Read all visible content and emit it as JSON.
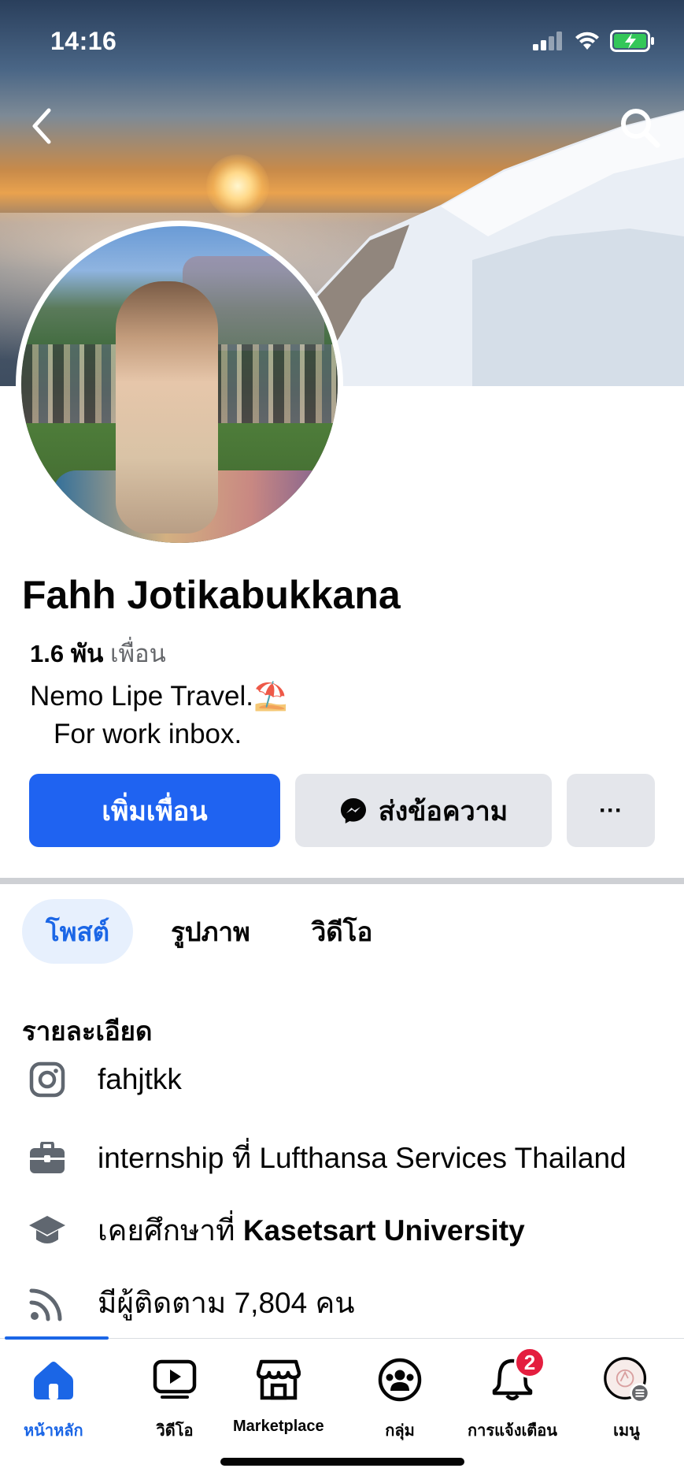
{
  "status": {
    "time": "14:16"
  },
  "profile": {
    "name": "Fahh Jotikabukkana",
    "friends_count": "1.6 พัน",
    "friends_label": "เพื่อน",
    "bio_line1": "Nemo Lipe Travel.",
    "bio_emoji": "⛱️",
    "bio_line2": "For work inbox."
  },
  "actions": {
    "add_friend": "เพิ่มเพื่อน",
    "message": "ส่งข้อความ",
    "more": "···"
  },
  "tabs": [
    {
      "label": "โพสต์",
      "active": true
    },
    {
      "label": "รูปภาพ",
      "active": false
    },
    {
      "label": "วิดีโอ",
      "active": false
    }
  ],
  "details": {
    "title": "รายละเอียด",
    "instagram": "fahjtkk",
    "work": "internship ที่ Lufthansa Services Thailand",
    "education_prefix": "เคยศึกษาที่ ",
    "education_school": "Kasetsart University",
    "followers": "มีผู้ติดตาม 7,804 คน"
  },
  "bottom_nav": {
    "items": [
      {
        "label": "หน้าหลัก",
        "icon": "home-icon",
        "active": true
      },
      {
        "label": "วิดีโอ",
        "icon": "video-icon",
        "active": false
      },
      {
        "label": "Marketplace",
        "icon": "marketplace-icon",
        "active": false
      },
      {
        "label": "กลุ่ม",
        "icon": "groups-icon",
        "active": false
      },
      {
        "label": "การแจ้งเตือน",
        "icon": "bell-icon",
        "active": false,
        "badge": "2"
      },
      {
        "label": "เมนู",
        "icon": "menu-avatar-icon",
        "active": false
      }
    ]
  },
  "colors": {
    "accent": "#1f63f1",
    "accent_text": "#1b66e6",
    "badge": "#e41e3f",
    "secondary_button": "#e4e6eb"
  }
}
